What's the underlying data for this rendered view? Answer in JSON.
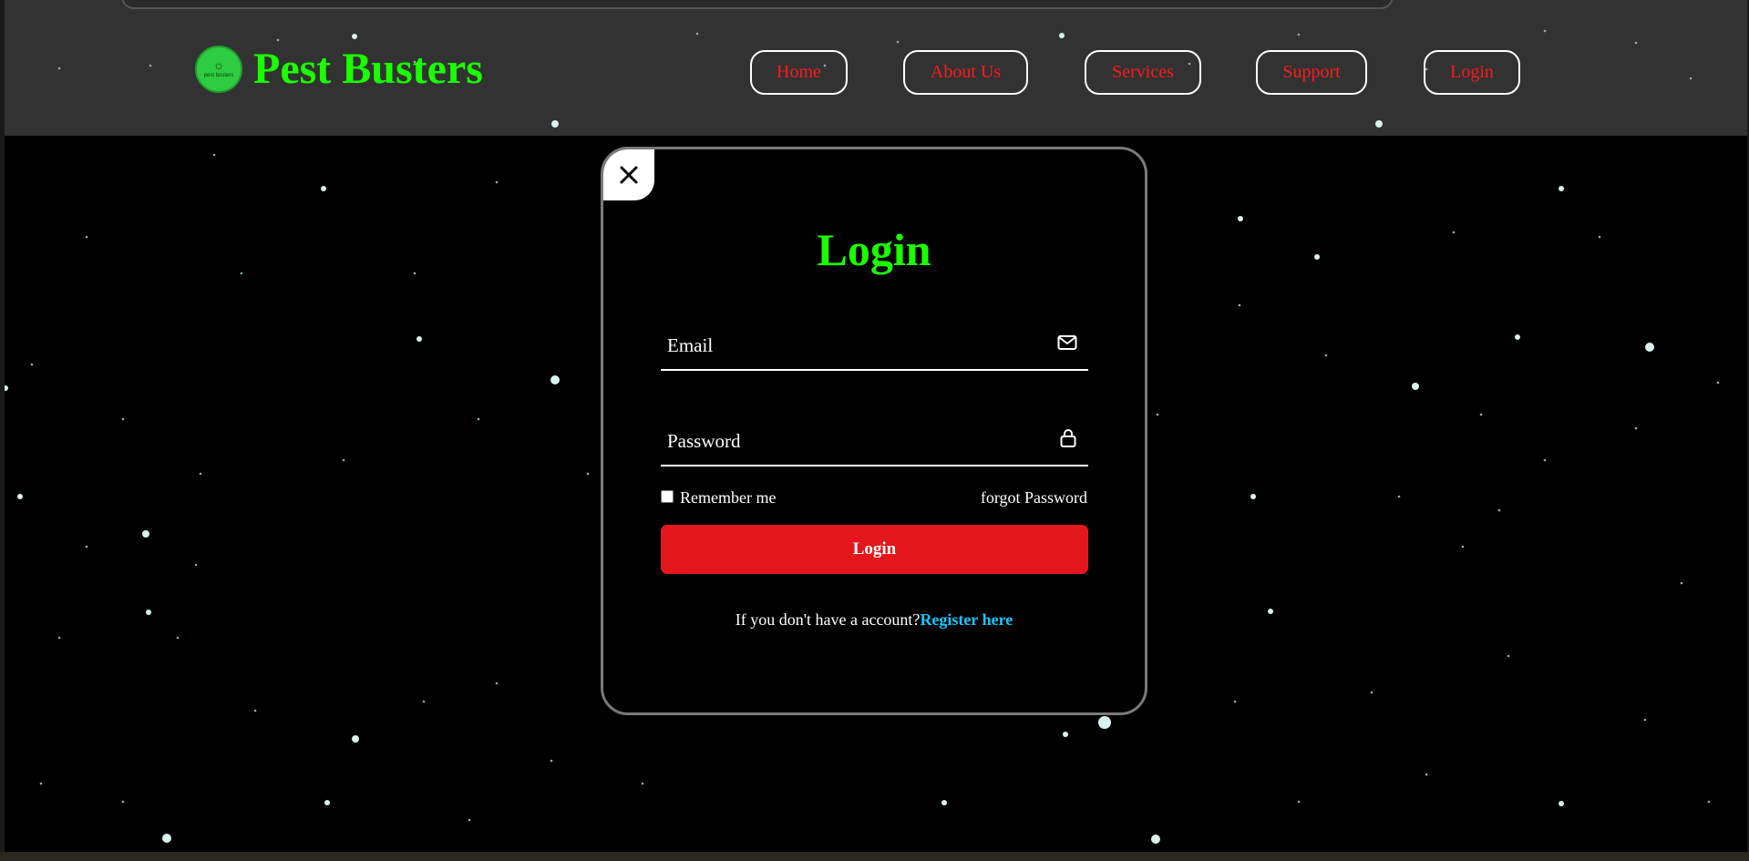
{
  "header": {
    "brand": "Pest Busters",
    "logo_text": "pest busters",
    "logo_icon": "bug-icon",
    "nav": [
      "Home",
      "About Us",
      "Services",
      "Support",
      "Login"
    ]
  },
  "login_modal": {
    "close_icon": "close-icon",
    "title": "Login",
    "email_placeholder": "Email",
    "email_icon": "mail-icon",
    "password_placeholder": "Password",
    "password_icon": "lock-icon",
    "remember_label": "Remember me",
    "remember_checked": false,
    "forgot_label": "forgot Password",
    "submit_label": "Login",
    "register_prompt": "If you don't have a account?",
    "register_link": "Register here"
  },
  "colors": {
    "brand_green": "#1aff00",
    "nav_text_red": "#ff1a1a",
    "button_red": "#e3171b",
    "link_cyan": "#14c8ff",
    "header_bg": "#323232",
    "page_bg": "#000000"
  }
}
